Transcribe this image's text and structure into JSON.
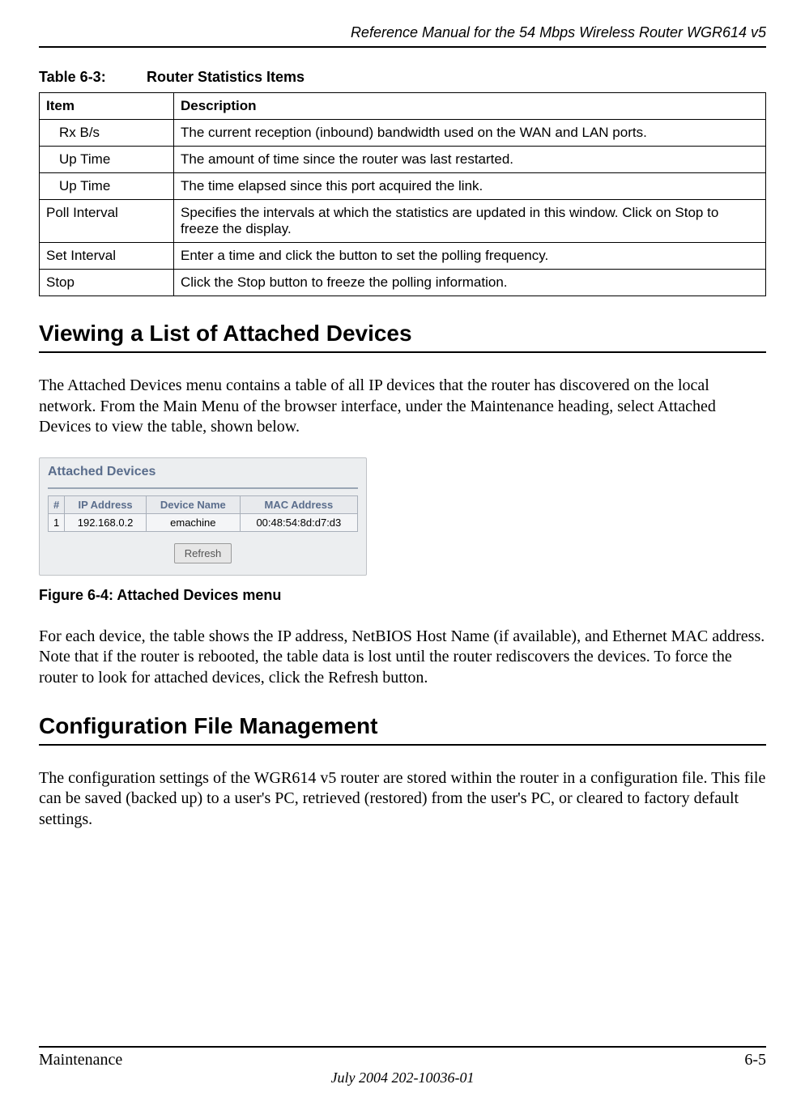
{
  "header": {
    "running_title": "Reference Manual for the 54 Mbps Wireless Router WGR614 v5"
  },
  "table_caption": {
    "label": "Table 6-3:",
    "title": "Router Statistics Items"
  },
  "table": {
    "headers": {
      "item": "Item",
      "description": "Description"
    },
    "rows": [
      {
        "item_indent": true,
        "item": "Rx B/s",
        "desc": "The current reception (inbound) bandwidth used on the WAN and LAN ports."
      },
      {
        "item_indent": true,
        "item": "Up Time",
        "desc": "The amount of time since the router was last restarted."
      },
      {
        "item_indent": true,
        "item": "Up Time",
        "desc": "The time elapsed since this port acquired the link."
      },
      {
        "item_indent": false,
        "item": "Poll Interval",
        "desc": "Specifies the intervals at which the statistics are updated in this window. Click on Stop to freeze the display."
      },
      {
        "item_indent": false,
        "item": "Set Interval",
        "desc": "Enter a time and click the button to set the polling frequency."
      },
      {
        "item_indent": false,
        "item": "Stop",
        "desc": "Click the Stop button to freeze the polling information."
      }
    ]
  },
  "section1": {
    "heading": "Viewing a List of Attached Devices",
    "para": "The Attached Devices menu contains a table of all IP devices that the router has discovered on the local network. From the Main Menu of the browser interface, under the Maintenance heading, select Attached Devices to view the table, shown below."
  },
  "figure": {
    "title": "Attached Devices",
    "headers": {
      "num": "#",
      "ip": "IP Address",
      "name": "Device Name",
      "mac": "MAC Address"
    },
    "row": {
      "num": "1",
      "ip": "192.168.0.2",
      "name": "emachine",
      "mac": "00:48:54:8d:d7:d3"
    },
    "refresh": "Refresh",
    "caption": "Figure 6-4:  Attached Devices menu"
  },
  "para2": "For each device, the table shows the IP address, NetBIOS Host Name (if available), and Ethernet MAC address. Note that if the router is rebooted, the table data is lost until the router rediscovers the devices. To force the router to look for attached devices, click the Refresh button.",
  "section2": {
    "heading": "Configuration File Management",
    "para": "The configuration settings of the WGR614 v5 router are stored within the router in a configuration file. This file can be saved (backed up) to a user's PC, retrieved (restored) from the user's PC, or cleared to factory default settings."
  },
  "footer": {
    "left": "Maintenance",
    "right": "6-5",
    "center": "July 2004 202-10036-01"
  }
}
